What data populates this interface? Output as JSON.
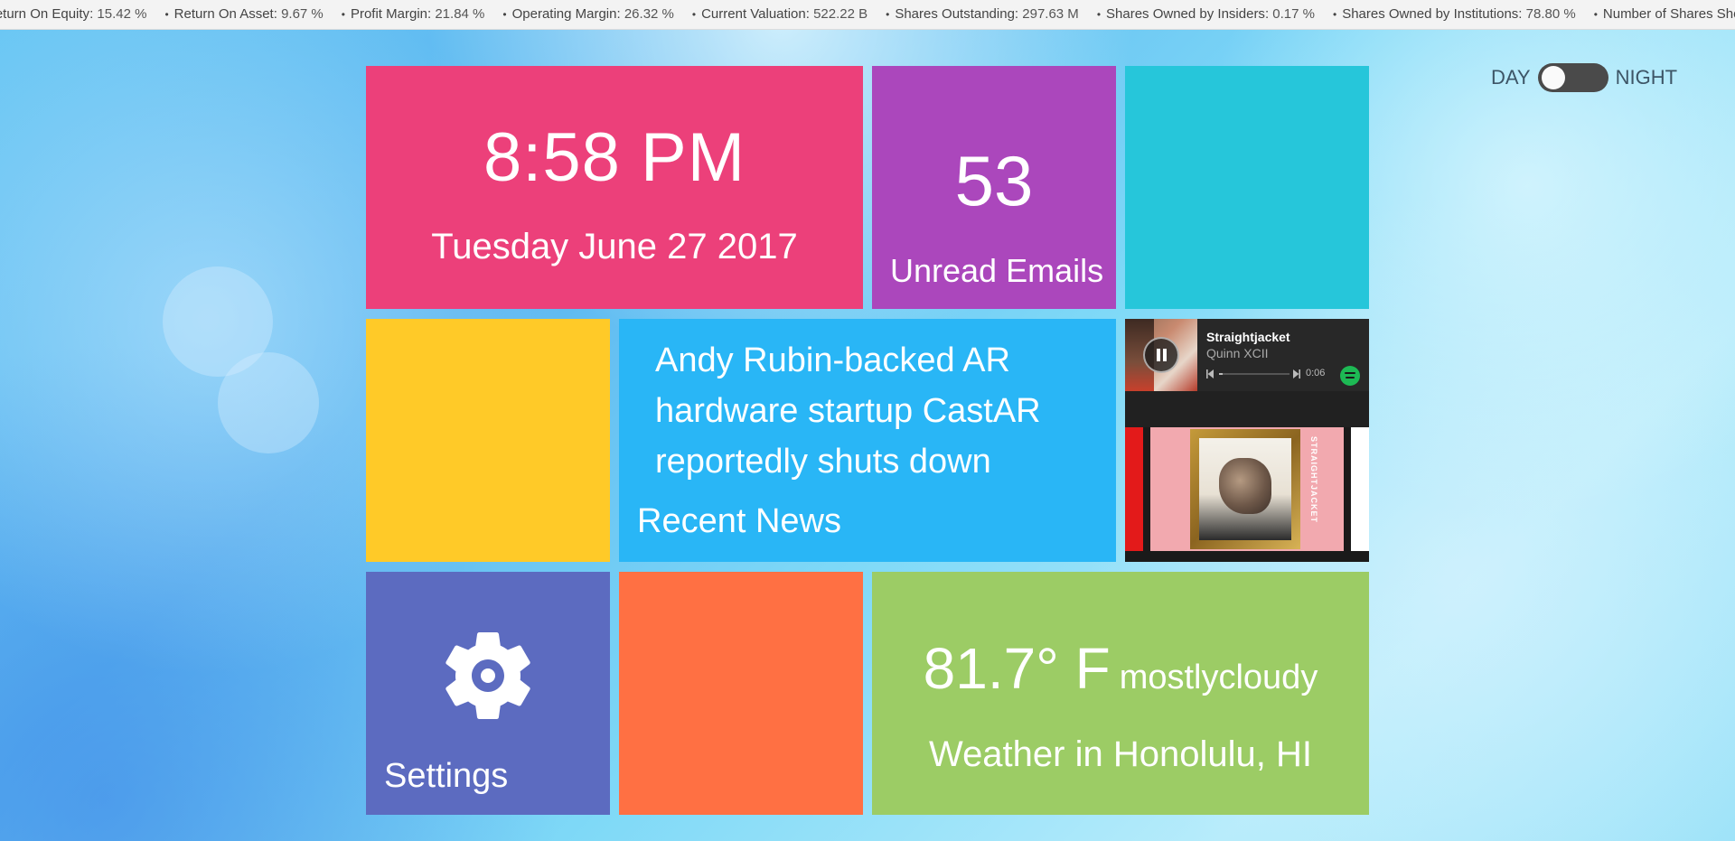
{
  "ticker": [
    {
      "label": "Return On Equity",
      "value": "15.42 %"
    },
    {
      "label": "Return On Asset",
      "value": "9.67 %"
    },
    {
      "label": "Profit Margin",
      "value": "21.84 %"
    },
    {
      "label": "Operating Margin",
      "value": "26.32 %"
    },
    {
      "label": "Current Valuation",
      "value": "522.22 B"
    },
    {
      "label": "Shares Outstanding",
      "value": "297.63 M"
    },
    {
      "label": "Shares Owned by Insiders",
      "value": "0.17 %"
    },
    {
      "label": "Shares Owned by Institutions",
      "value": "78.80 %"
    },
    {
      "label": "Number of Shares Shorted",
      "value": ""
    }
  ],
  "mode_toggle": {
    "day_label": "DAY",
    "night_label": "NIGHT",
    "state": "day"
  },
  "clock": {
    "time": "8:58 PM",
    "date": "Tuesday June 27 2017"
  },
  "email": {
    "count": "53",
    "label": "Unread Emails"
  },
  "news": {
    "headline": "Andy Rubin-backed AR hardware startup CastAR reportedly shuts down",
    "label": "Recent News"
  },
  "music": {
    "title": "Straightjacket",
    "artist": "Quinn XCII",
    "elapsed": "0:06",
    "progress_fraction": 0.05,
    "album_text": "STRAIGHTJACKET"
  },
  "settings": {
    "label": "Settings"
  },
  "weather": {
    "temp": "81.7° F",
    "condition": "mostlycloudy",
    "location": "Weather in Honolulu, HI"
  },
  "colors": {
    "clock_tile": "#ec407a",
    "email_tile": "#ab47bc",
    "teal_tile": "#26c6da",
    "yellow_tile": "#ffca28",
    "news_tile": "#29b6f6",
    "settings_tile": "#5c6bc0",
    "orange_tile": "#ff7043",
    "weather_tile": "#9ccc65",
    "spotify_green": "#1db954"
  }
}
